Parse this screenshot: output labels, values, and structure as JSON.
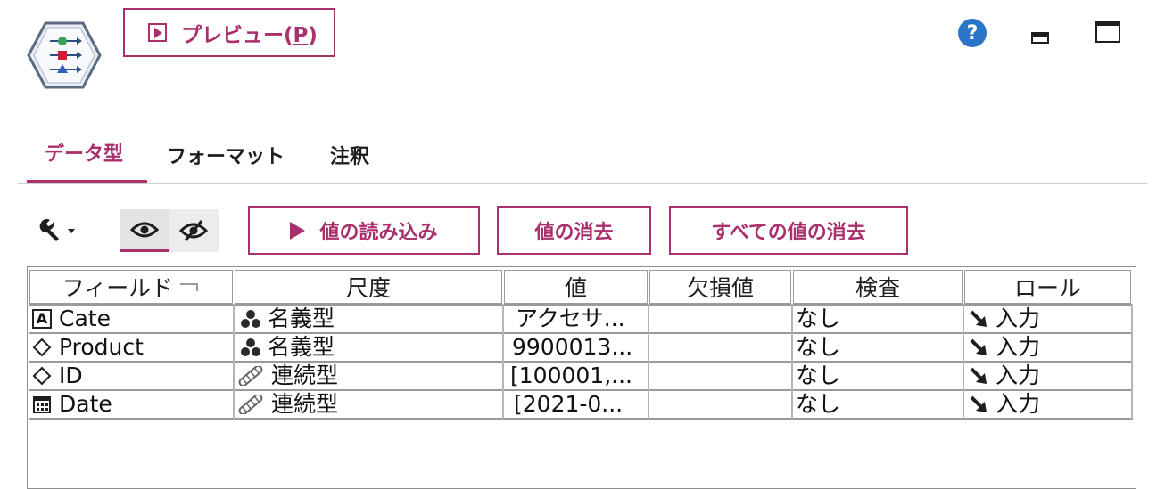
{
  "toolbar": {
    "preview_label": "プレビュー(",
    "preview_mnemonic": "P",
    "preview_suffix": ")",
    "help_glyph": "?"
  },
  "tabs": [
    {
      "label": "データ型",
      "active": true
    },
    {
      "label": "フォーマット",
      "active": false
    },
    {
      "label": "注釈",
      "active": false
    }
  ],
  "actions": {
    "read_values": "値の読み込み",
    "clear_values": "値の消去",
    "clear_all_values": "すべての値の消去"
  },
  "table": {
    "columns": [
      "フィールド",
      "尺度",
      "値",
      "欠損値",
      "検査",
      "ロール"
    ],
    "rows": [
      {
        "field": "Cate",
        "field_icon": "string-type-icon",
        "measure": "名義型",
        "measure_icon": "nominal-icon",
        "values": "アクセサ...",
        "missing": "",
        "check": "なし",
        "role": "入力",
        "role_icon": "input-arrow-icon"
      },
      {
        "field": "Product",
        "field_icon": "diamond-type-icon",
        "measure": "名義型",
        "measure_icon": "nominal-icon",
        "values": "9900013...",
        "missing": "",
        "check": "なし",
        "role": "入力",
        "role_icon": "input-arrow-icon"
      },
      {
        "field": "ID",
        "field_icon": "diamond-type-icon",
        "measure": "連続型",
        "measure_icon": "continuous-icon",
        "values": "[100001,...",
        "missing": "",
        "check": "なし",
        "role": "入力",
        "role_icon": "input-arrow-icon"
      },
      {
        "field": "Date",
        "field_icon": "calendar-type-icon",
        "measure": "連続型",
        "measure_icon": "continuous-icon",
        "values": "[2021-0...",
        "missing": "",
        "check": "なし",
        "role": "入力",
        "role_icon": "input-arrow-icon"
      }
    ]
  },
  "colors": {
    "accent": "#a8306c",
    "help": "#2b75c9"
  }
}
